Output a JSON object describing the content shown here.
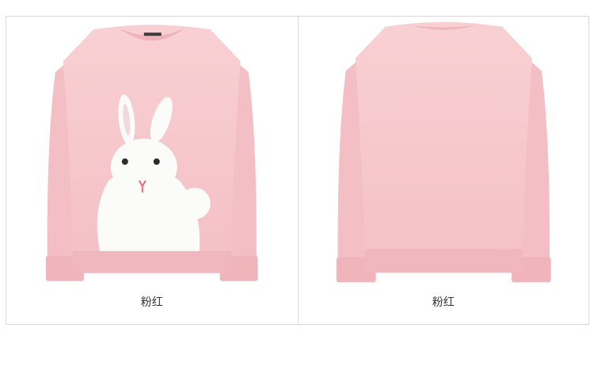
{
  "gallery": {
    "items": [
      {
        "view": "front",
        "caption": "粉红",
        "icon": "rabbit-sweater-front-image"
      },
      {
        "view": "back",
        "caption": "粉红",
        "icon": "sweater-back-image"
      }
    ]
  },
  "colors": {
    "sweater": "#f7c9cd",
    "sweater_shade": "#f2b9be",
    "rabbit": "#fbfbf9",
    "border": "#d9d9d9"
  }
}
